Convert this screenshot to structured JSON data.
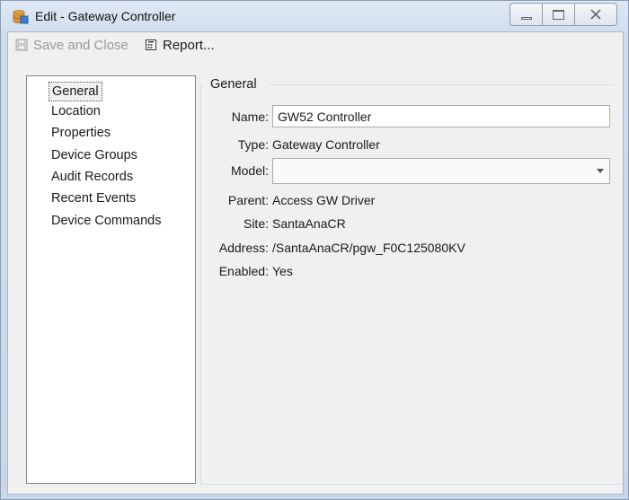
{
  "window": {
    "title": "Edit - Gateway Controller"
  },
  "toolbar": {
    "save_label": "Save and Close",
    "report_label": "Report..."
  },
  "nav": {
    "items": [
      {
        "label": "General"
      },
      {
        "label": "Location"
      },
      {
        "label": "Properties"
      },
      {
        "label": "Device Groups"
      },
      {
        "label": "Audit Records"
      },
      {
        "label": "Recent Events"
      },
      {
        "label": "Device Commands"
      }
    ],
    "selected": "General"
  },
  "general": {
    "group_title": "General",
    "name_label": "Name:",
    "name_value": "GW52 Controller",
    "type_label": "Type:",
    "type_value": "Gateway Controller",
    "model_label": "Model:",
    "model_value": "",
    "parent_label": "Parent:",
    "parent_value": "Access GW Driver",
    "site_label": "Site:",
    "site_value": "SantaAnaCR",
    "address_label": "Address:",
    "address_value": "/SantaAnaCR/pgw_F0C125080KV",
    "enabled_label": "Enabled:",
    "enabled_value": "Yes"
  }
}
